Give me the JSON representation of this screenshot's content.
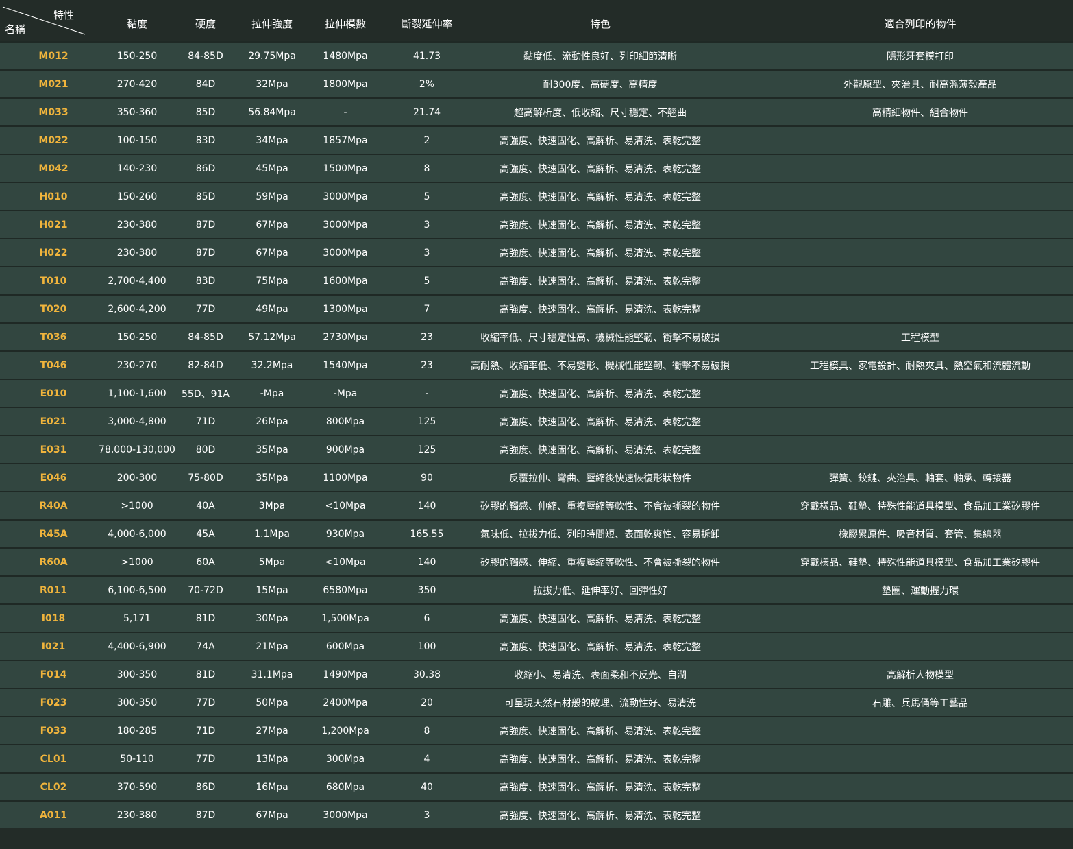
{
  "header": {
    "corner_top": "特性",
    "corner_bottom": "名稱",
    "columns": [
      "黏度",
      "硬度",
      "拉伸強度",
      "拉伸模數",
      "斷裂延伸率",
      "特色",
      "適合列印的物件"
    ]
  },
  "rows": [
    {
      "name": "M012",
      "viscosity": "150-250",
      "hardness": "84-85D",
      "tensile": "29.75Mpa",
      "modulus": "1480Mpa",
      "elongation": "41.73",
      "feature": "黏度低、流動性良好、列印細節清晰",
      "suitable": "隱形牙套模打印"
    },
    {
      "name": "M021",
      "viscosity": "270-420",
      "hardness": "84D",
      "tensile": "32Mpa",
      "modulus": "1800Mpa",
      "elongation": "2%",
      "feature": "耐300度、高硬度、高精度",
      "suitable": "外觀原型、夾治具、耐高溫薄殼產品"
    },
    {
      "name": "M033",
      "viscosity": "350-360",
      "hardness": "85D",
      "tensile": "56.84Mpa",
      "modulus": "-",
      "elongation": "21.74",
      "feature": "超高解析度、低收縮、尺寸穩定、不翹曲",
      "suitable": "高精細物件、組合物件"
    },
    {
      "name": "M022",
      "viscosity": "100-150",
      "hardness": "83D",
      "tensile": "34Mpa",
      "modulus": "1857Mpa",
      "elongation": "2",
      "feature": "高強度、快速固化、高解析、易清洗、表乾完整",
      "suitable": ""
    },
    {
      "name": "M042",
      "viscosity": "140-230",
      "hardness": "86D",
      "tensile": "45Mpa",
      "modulus": "1500Mpa",
      "elongation": "8",
      "feature": "高強度、快速固化、高解析、易清洗、表乾完整",
      "suitable": ""
    },
    {
      "name": "H010",
      "viscosity": "150-260",
      "hardness": "85D",
      "tensile": "59Mpa",
      "modulus": "3000Mpa",
      "elongation": "5",
      "feature": "高強度、快速固化、高解析、易清洗、表乾完整",
      "suitable": ""
    },
    {
      "name": "H021",
      "viscosity": "230-380",
      "hardness": "87D",
      "tensile": "67Mpa",
      "modulus": "3000Mpa",
      "elongation": "3",
      "feature": "高強度、快速固化、高解析、易清洗、表乾完整",
      "suitable": ""
    },
    {
      "name": "H022",
      "viscosity": "230-380",
      "hardness": "87D",
      "tensile": "67Mpa",
      "modulus": "3000Mpa",
      "elongation": "3",
      "feature": "高強度、快速固化、高解析、易清洗、表乾完整",
      "suitable": ""
    },
    {
      "name": "T010",
      "viscosity": "2,700-4,400",
      "hardness": "83D",
      "tensile": "75Mpa",
      "modulus": "1600Mpa",
      "elongation": "5",
      "feature": "高強度、快速固化、高解析、易清洗、表乾完整",
      "suitable": ""
    },
    {
      "name": "T020",
      "viscosity": "2,600-4,200",
      "hardness": "77D",
      "tensile": "49Mpa",
      "modulus": "1300Mpa",
      "elongation": "7",
      "feature": "高強度、快速固化、高解析、易清洗、表乾完整",
      "suitable": ""
    },
    {
      "name": "T036",
      "viscosity": "150-250",
      "hardness": "84-85D",
      "tensile": "57.12Mpa",
      "modulus": "2730Mpa",
      "elongation": "23",
      "feature": "收縮率低、尺寸穩定性高、機械性能堅韌、衝擊不易破損",
      "suitable": "工程模型"
    },
    {
      "name": "T046",
      "viscosity": "230-270",
      "hardness": "82-84D",
      "tensile": "32.2Mpa",
      "modulus": "1540Mpa",
      "elongation": "23",
      "feature": "高耐熱、收縮率低、不易變形、機械性能堅韌、衝擊不易破損",
      "suitable": "工程模具、家電設計、耐熱夾具、熱空氣和流體流動"
    },
    {
      "name": "E010",
      "viscosity": "1,100-1,600",
      "hardness": "55D、91A",
      "tensile": "-Mpa",
      "modulus": "-Mpa",
      "elongation": "-",
      "feature": "高強度、快速固化、高解析、易清洗、表乾完整",
      "suitable": ""
    },
    {
      "name": "E021",
      "viscosity": "3,000-4,800",
      "hardness": "71D",
      "tensile": "26Mpa",
      "modulus": "800Mpa",
      "elongation": "125",
      "feature": "高強度、快速固化、高解析、易清洗、表乾完整",
      "suitable": ""
    },
    {
      "name": "E031",
      "viscosity": "78,000-130,000",
      "hardness": "80D",
      "tensile": "35Mpa",
      "modulus": "900Mpa",
      "elongation": "125",
      "feature": "高強度、快速固化、高解析、易清洗、表乾完整",
      "suitable": ""
    },
    {
      "name": "E046",
      "viscosity": "200-300",
      "hardness": "75-80D",
      "tensile": "35Mpa",
      "modulus": "1100Mpa",
      "elongation": "90",
      "feature": "反覆拉伸、彎曲、壓縮後快速恢復形狀物件",
      "suitable": "彈簧、鉸鏈、夾治具、軸套、軸承、轉接器"
    },
    {
      "name": "R40A",
      "viscosity": ">1000",
      "hardness": "40A",
      "tensile": "3Mpa",
      "modulus": "<10Mpa",
      "elongation": "140",
      "feature": "矽膠的觸感、伸縮、重複壓縮等軟性、不會被撕裂的物件",
      "suitable": "穿戴樣品、鞋墊、特殊性能道具模型、食品加工業矽膠件"
    },
    {
      "name": "R45A",
      "viscosity": "4,000-6,000",
      "hardness": "45A",
      "tensile": "1.1Mpa",
      "modulus": "930Mpa",
      "elongation": "165.55",
      "feature": "氣味低、拉拔力低、列印時間短、表面乾爽性、容易拆卸",
      "suitable": "橡膠累原件、吸音材質、套管、集線器"
    },
    {
      "name": "R60A",
      "viscosity": ">1000",
      "hardness": "60A",
      "tensile": "5Mpa",
      "modulus": "<10Mpa",
      "elongation": "140",
      "feature": "矽膠的觸感、伸縮、重複壓縮等軟性、不會被撕裂的物件",
      "suitable": "穿戴樣品、鞋墊、特殊性能道具模型、食品加工業矽膠件"
    },
    {
      "name": "R011",
      "viscosity": "6,100-6,500",
      "hardness": "70-72D",
      "tensile": "15Mpa",
      "modulus": "6580Mpa",
      "elongation": "350",
      "feature": "拉拔力低、延伸率好、回彈性好",
      "suitable": "墊圈、運動握力環"
    },
    {
      "name": "I018",
      "viscosity": "5,171",
      "hardness": "81D",
      "tensile": "30Mpa",
      "modulus": "1,500Mpa",
      "elongation": "6",
      "feature": "高強度、快速固化、高解析、易清洗、表乾完整",
      "suitable": ""
    },
    {
      "name": "I021",
      "viscosity": "4,400-6,900",
      "hardness": "74A",
      "tensile": "21Mpa",
      "modulus": "600Mpa",
      "elongation": "100",
      "feature": "高強度、快速固化、高解析、易清洗、表乾完整",
      "suitable": ""
    },
    {
      "name": "F014",
      "viscosity": "300-350",
      "hardness": "81D",
      "tensile": "31.1Mpa",
      "modulus": "1490Mpa",
      "elongation": "30.38",
      "feature": "收縮小、易清洗、表面柔和不反光、自潤",
      "suitable": "高解析人物模型"
    },
    {
      "name": "F023",
      "viscosity": "300-350",
      "hardness": "77D",
      "tensile": "50Mpa",
      "modulus": "2400Mpa",
      "elongation": "20",
      "feature": "可呈現天然石材般的紋理、流動性好、易清洗",
      "suitable": "石雕、兵馬俑等工藝品"
    },
    {
      "name": "F033",
      "viscosity": "180-285",
      "hardness": "71D",
      "tensile": "27Mpa",
      "modulus": "1,200Mpa",
      "elongation": "8",
      "feature": "高強度、快速固化、高解析、易清洗、表乾完整",
      "suitable": ""
    },
    {
      "name": "CL01",
      "viscosity": "50-110",
      "hardness": "77D",
      "tensile": "13Mpa",
      "modulus": "300Mpa",
      "elongation": "4",
      "feature": "高強度、快速固化、高解析、易清洗、表乾完整",
      "suitable": ""
    },
    {
      "name": "CL02",
      "viscosity": "370-590",
      "hardness": "86D",
      "tensile": "16Mpa",
      "modulus": "680Mpa",
      "elongation": "40",
      "feature": "高強度、快速固化、高解析、易清洗、表乾完整",
      "suitable": ""
    },
    {
      "name": "A011",
      "viscosity": "230-380",
      "hardness": "87D",
      "tensile": "67Mpa",
      "modulus": "3000Mpa",
      "elongation": "3",
      "feature": "高強度、快速固化、高解析、易清洗、表乾完整",
      "suitable": ""
    }
  ],
  "colors": {
    "background": "#232c28",
    "row_background": "#324640",
    "row_separator": "#1f2925",
    "name_text": "#f0b43c",
    "text": "#ffffff"
  }
}
